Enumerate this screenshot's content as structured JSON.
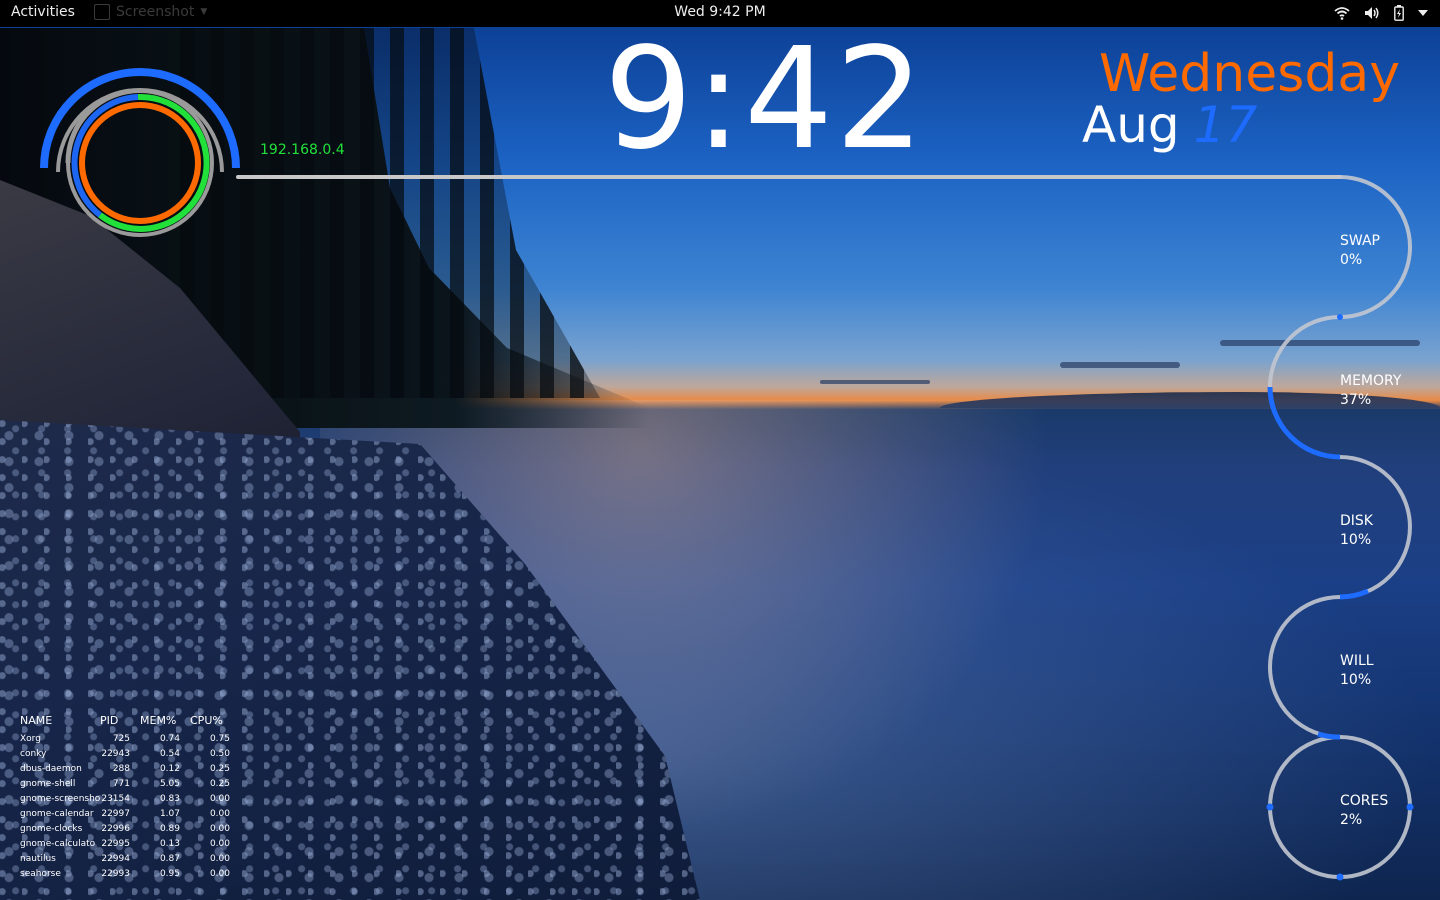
{
  "top_bar": {
    "activities": "Activities",
    "app_name": "Screenshot",
    "clock": "Wed  9:42 PM",
    "icons": [
      "wifi-icon",
      "volume-icon",
      "battery-icon",
      "system-menu-arrow-icon"
    ]
  },
  "conky": {
    "time": "9:42",
    "day_name": "Wednesday",
    "month": "Aug",
    "day": "17",
    "ip": "192.168.0.4",
    "accent_colors": {
      "orange": "#ff6a00",
      "blue": "#1e6bff",
      "green": "#22e03a",
      "track": "#b8b8b8"
    },
    "meters": [
      {
        "label": "SWAP",
        "value": "0%",
        "fraction": 0.0
      },
      {
        "label": "MEMORY",
        "value": "37%",
        "fraction": 0.37
      },
      {
        "label": "DISK",
        "value": "10%",
        "fraction": 0.1
      },
      {
        "label": "WILL",
        "value": "10%",
        "fraction": 0.1
      },
      {
        "label": "CORES",
        "value": "2%",
        "fraction": 0.02
      }
    ],
    "processes": {
      "headers": [
        "NAME",
        "PID",
        "MEM%",
        "CPU%"
      ],
      "rows": [
        {
          "name": "Xorg",
          "pid": "725",
          "mem": "0.74",
          "cpu": "0.75"
        },
        {
          "name": "conky",
          "pid": "22943",
          "mem": "0.54",
          "cpu": "0.50"
        },
        {
          "name": "dbus-daemon",
          "pid": "288",
          "mem": "0.12",
          "cpu": "0.25"
        },
        {
          "name": "gnome-shell",
          "pid": "771",
          "mem": "5.05",
          "cpu": "0.25"
        },
        {
          "name": "gnome-screensho",
          "pid": "23154",
          "mem": "0.83",
          "cpu": "0.00"
        },
        {
          "name": "gnome-calendar",
          "pid": "22997",
          "mem": "1.07",
          "cpu": "0.00"
        },
        {
          "name": "gnome-clocks",
          "pid": "22996",
          "mem": "0.89",
          "cpu": "0.00"
        },
        {
          "name": "gnome-calculato",
          "pid": "22995",
          "mem": "0.13",
          "cpu": "0.00"
        },
        {
          "name": "nautilus",
          "pid": "22994",
          "mem": "0.87",
          "cpu": "0.00"
        },
        {
          "name": "seahorse",
          "pid": "22993",
          "mem": "0.95",
          "cpu": "0.00"
        }
      ]
    }
  }
}
